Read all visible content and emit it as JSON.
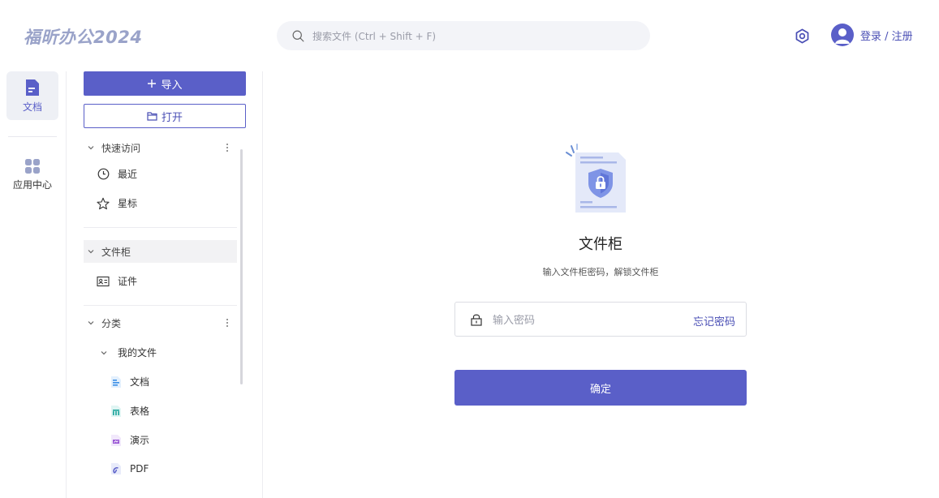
{
  "app": {
    "logo_text": "福昕办公2024"
  },
  "header": {
    "search_placeholder": "搜索文件 (Ctrl + Shift + F)",
    "login_label": "登录 / 注册"
  },
  "rail": {
    "items": [
      {
        "label": "文档",
        "active": true
      },
      {
        "label": "应用中心",
        "active": false
      }
    ]
  },
  "nav": {
    "import_label": "导入",
    "open_label": "打开",
    "quick_access": {
      "title": "快速访问",
      "items": [
        {
          "label": "最近"
        },
        {
          "label": "星标"
        }
      ]
    },
    "cabinet": {
      "title": "文件柜",
      "items": [
        {
          "label": "证件"
        }
      ]
    },
    "category": {
      "title": "分类",
      "my_files": "我的文件",
      "items": [
        {
          "label": "文档"
        },
        {
          "label": "表格"
        },
        {
          "label": "演示"
        },
        {
          "label": "PDF"
        }
      ]
    }
  },
  "main": {
    "title": "文件柜",
    "subtitle": "输入文件柜密码，解锁文件柜",
    "password_placeholder": "输入密码",
    "forgot_label": "忘记密码",
    "confirm_label": "确定"
  },
  "colors": {
    "accent": "#5a5fc8",
    "link": "#4a4fb5"
  }
}
